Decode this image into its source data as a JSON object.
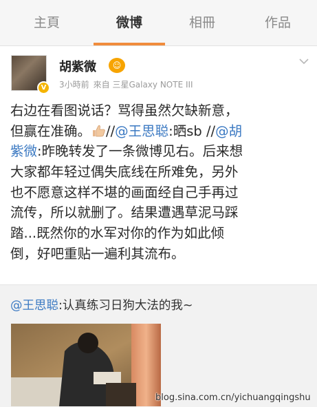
{
  "tabs": [
    {
      "label": "主頁",
      "active": false
    },
    {
      "label": "微博",
      "active": true
    },
    {
      "label": "相冊",
      "active": false
    },
    {
      "label": "作品",
      "active": false
    }
  ],
  "post": {
    "username": "胡紫微",
    "time": "3小時前",
    "source": "來自 三星Galaxy NOTE III",
    "lines": [
      [
        {
          "t": "右边在看图说话？骂得虽然欠缺新意，",
          "m": false
        }
      ],
      [
        {
          "t": "但赢在准确。",
          "m": false
        },
        {
          "icon": "thumbs-up-icon"
        },
        {
          "t": "//",
          "m": false
        },
        {
          "t": "@王思聪",
          "m": true
        },
        {
          "t": ":晒sb //",
          "m": false
        },
        {
          "t": "@胡",
          "m": true
        }
      ],
      [
        {
          "t": "紫微",
          "m": true
        },
        {
          "t": ":昨晚转发了一条微博见右。后来想",
          "m": false
        }
      ],
      [
        {
          "t": "大家都年轻过偶失底线在所难免，另外",
          "m": false
        }
      ],
      [
        {
          "t": "也不愿意这样不堪的画面经自己手再过",
          "m": false
        }
      ],
      [
        {
          "t": "流传，所以就删了。结果遭遇草泥马踩",
          "m": false
        }
      ],
      [
        {
          "t": "踏...既然你的水军对你的作为如此倾",
          "m": false
        }
      ],
      [
        {
          "t": "倒，好吧重贴一遍利其流布。",
          "m": false
        }
      ]
    ]
  },
  "repost": {
    "mention": "@王思聪",
    "text": ":认真练习日狗大法的我~"
  },
  "watermark": "blog.sina.com.cn/yichuangqingshu",
  "colors": {
    "accent": "#f08c3c",
    "mention": "#3b79c2",
    "badge": "#f5b400"
  }
}
